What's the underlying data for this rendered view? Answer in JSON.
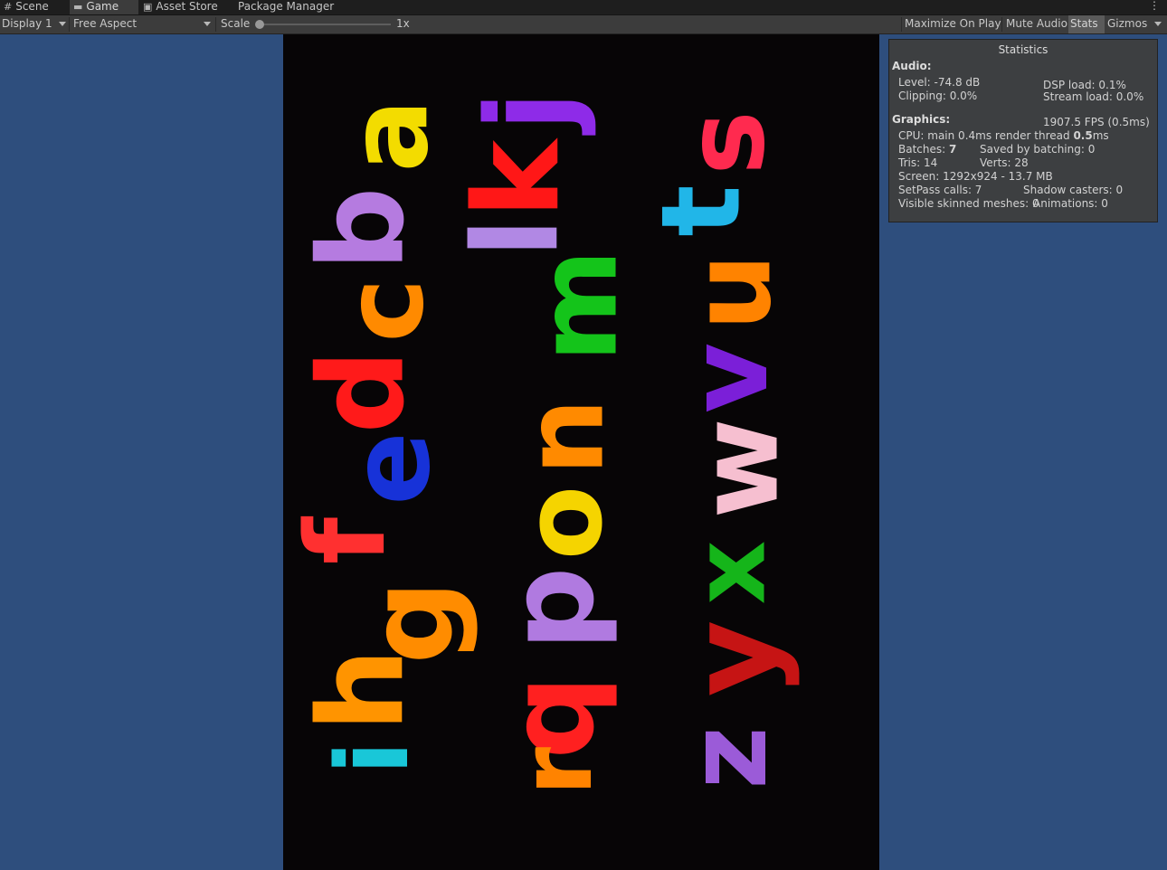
{
  "tabs": [
    {
      "label": "Scene",
      "icon": "hash-icon"
    },
    {
      "label": "Game",
      "icon": "gamepad-icon"
    },
    {
      "label": "Asset Store",
      "icon": "bag-icon"
    },
    {
      "label": "Package Manager",
      "icon": ""
    }
  ],
  "toolbar": {
    "display": "Display 1",
    "aspect": "Free Aspect",
    "scale_label": "Scale",
    "scale_value": "1x",
    "maximize": "Maximize On Play",
    "mute": "Mute Audio",
    "stats": "Stats",
    "gizmos": "Gizmos"
  },
  "stats": {
    "title": "Statistics",
    "audio_label": "Audio:",
    "level": "Level: -74.8 dB",
    "dsp": "DSP load: 0.1%",
    "clipping": "Clipping: 0.0%",
    "stream": "Stream load: 0.0%",
    "graphics_label": "Graphics:",
    "fps": "1907.5 FPS (0.5ms)",
    "cpu_prefix": "CPU: main 0.4ms  render thread ",
    "cpu_bold": "0.5",
    "cpu_suffix": "ms",
    "batches_prefix": "Batches: ",
    "batches_value": "7",
    "saved": "Saved by batching: 0",
    "tris": "Tris: 14",
    "verts": "Verts: 28",
    "screen": "Screen: 1292x924 - 13.7 MB",
    "setpass": "SetPass calls: 7",
    "shadow": "Shadow casters: 0",
    "skinned": "Visible skinned meshes: 0",
    "animations": "Animations: 0"
  },
  "colors": {
    "background": "#2e4e7d",
    "game_bg": "#070506"
  },
  "letters": [
    {
      "ch": "a",
      "color": "#f3dc00"
    },
    {
      "ch": "b",
      "color": "#b57be0"
    },
    {
      "ch": "c",
      "color": "#ff8a00"
    },
    {
      "ch": "d",
      "color": "#ff1a1a"
    },
    {
      "ch": "e",
      "color": "#1732d8"
    },
    {
      "ch": "f",
      "color": "#ff3030"
    },
    {
      "ch": "g",
      "color": "#ff8c00"
    },
    {
      "ch": "h",
      "color": "#ff9400"
    },
    {
      "ch": "i",
      "color": "#19c7d8"
    },
    {
      "ch": "j",
      "color": "#8e2be8"
    },
    {
      "ch": "k",
      "color": "#ff1717"
    },
    {
      "ch": "l",
      "color": "#b188e4"
    },
    {
      "ch": "m",
      "color": "#14c41a"
    },
    {
      "ch": "n",
      "color": "#ff8a00"
    },
    {
      "ch": "o",
      "color": "#f5d400"
    },
    {
      "ch": "p",
      "color": "#b07ae0"
    },
    {
      "ch": "q",
      "color": "#ff2020"
    },
    {
      "ch": "r",
      "color": "#ff8300"
    },
    {
      "ch": "s",
      "color": "#ff2a4f"
    },
    {
      "ch": "t",
      "color": "#21b6e8"
    },
    {
      "ch": "u",
      "color": "#ff8300"
    },
    {
      "ch": "v",
      "color": "#7b1fd8"
    },
    {
      "ch": "w",
      "color": "#f6bfd0"
    },
    {
      "ch": "x",
      "color": "#15b51a"
    },
    {
      "ch": "y",
      "color": "#c61414"
    },
    {
      "ch": "z",
      "color": "#9b5bd8"
    }
  ]
}
